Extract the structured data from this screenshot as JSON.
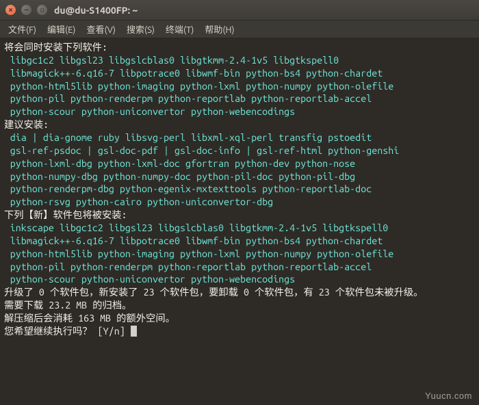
{
  "window": {
    "title": "du@du-S1400FP: ~"
  },
  "menu": {
    "file": "文件(F)",
    "edit": "编辑(E)",
    "view": "查看(V)",
    "search": "搜索(S)",
    "terminal": "终端(T)",
    "help": "帮助(H)"
  },
  "output": {
    "h1": "将会同时安装下列软件:",
    "block1": [
      "libgc1c2 libgsl23 libgslcblas0 libgtkmm-2.4-1v5 libgtkspell0",
      "libmagick++-6.q16-7 libpotrace0 libwmf-bin python-bs4 python-chardet",
      "python-html5lib python-imaging python-lxml python-numpy python-olefile",
      "python-pil python-renderpm python-reportlab python-reportlab-accel",
      "python-scour python-uniconvertor python-webencodings"
    ],
    "h2": "建议安装:",
    "block2": [
      "dia | dia-gnome ruby libsvg-perl libxml-xql-perl transfig pstoedit",
      "gsl-ref-psdoc | gsl-doc-pdf | gsl-doc-info | gsl-ref-html python-genshi",
      "python-lxml-dbg python-lxml-doc gfortran python-dev python-nose",
      "python-numpy-dbg python-numpy-doc python-pil-doc python-pil-dbg",
      "python-renderpm-dbg python-egenix-mxtexttools python-reportlab-doc",
      "python-rsvg python-cairo python-uniconvertor-dbg"
    ],
    "h3": "下列【新】软件包将被安装:",
    "block3": [
      "inkscape libgc1c2 libgsl23 libgslcblas0 libgtkmm-2.4-1v5 libgtkspell0",
      "libmagick++-6.q16-7 libpotrace0 libwmf-bin python-bs4 python-chardet",
      "python-html5lib python-imaging python-lxml python-numpy python-olefile",
      "python-pil python-renderpm python-reportlab python-reportlab-accel",
      "python-scour python-uniconvertor python-webencodings"
    ],
    "summary1": "升级了 0 个软件包，新安装了 23 个软件包，要卸载 0 个软件包，有 23 个软件包未被升级。",
    "summary2": "需要下载 23.2 MB 的归档。",
    "summary3": "解压缩后会消耗 163 MB 的额外空间。",
    "prompt": "您希望继续执行吗？ [Y/n] "
  },
  "watermark": "Yuucn.com"
}
